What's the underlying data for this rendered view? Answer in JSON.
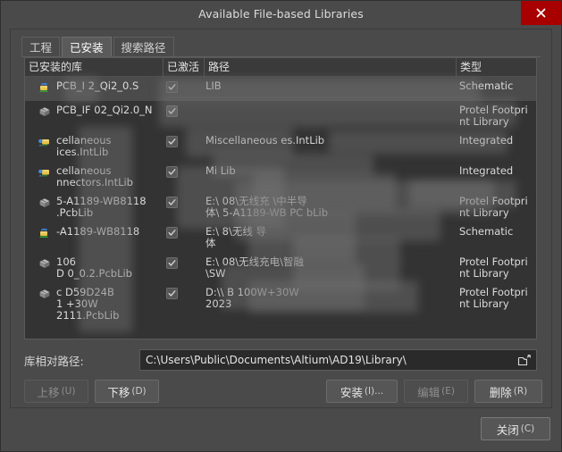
{
  "window": {
    "title": "Available File-based Libraries",
    "close_icon": "close-x-icon"
  },
  "tabs": [
    {
      "label": "工程",
      "active": false
    },
    {
      "label": "已安装",
      "active": true
    },
    {
      "label": "搜索路径",
      "active": false
    }
  ],
  "list": {
    "columns": [
      {
        "key": "name",
        "label": "已安装的库"
      },
      {
        "key": "activated",
        "label": "已激活"
      },
      {
        "key": "path",
        "label": "路径"
      },
      {
        "key": "type",
        "label": "类型"
      }
    ],
    "rows": [
      {
        "name": "PCB_I          2_Qi2_0.S",
        "activated": true,
        "path": "                                                  LIB",
        "type": "Schematic",
        "icon": "schematic-library-icon",
        "selected": true
      },
      {
        "name": "PCB_IF     02_Qi2.0_N",
        "activated": true,
        "path": "",
        "type": "Protel Footprint Library",
        "icon": "pcb-footprint-library-icon",
        "selected": false
      },
      {
        "name": "     cellaneous\n     ices.IntLib",
        "activated": true,
        "path": "Miscellaneous          es.IntLib",
        "type": "Integrated",
        "icon": "integrated-library-icon",
        "selected": false
      },
      {
        "name": "     cellaneous\n     nnectors.IntLib",
        "activated": true,
        "path": "Mi                              Lib",
        "type": "Integrated",
        "icon": "integrated-library-icon",
        "selected": false
      },
      {
        "name": "   5-A1189-WB8118\n   .PcbLib",
        "activated": true,
        "path": "E:\\                         08\\无线充        \\中半导\n体\\   5-A1189-WB      PC     bLib",
        "type": "Protel Footprint Library",
        "icon": "pcb-footprint-library-icon",
        "selected": false
      },
      {
        "name": "   -A1189-WB8118",
        "activated": true,
        "path": "E:\\                         8\\无线                 导\n体",
        "type": "Schematic",
        "icon": "schematic-library-icon",
        "selected": false
      },
      {
        "name": "       106\n   D       0_0.2.PcbLib",
        "activated": true,
        "path": "E:\\                          08\\无线充电\\智融\n\\SW",
        "type": "Protel Footprint Library",
        "icon": "pcb-footprint-library-icon",
        "selected": false
      },
      {
        "name": "   c      D59D24B\n   1         +30W\n           2111.PcbLib",
        "activated": true,
        "path": "D:\\\\                         B 100W+30W\n2023",
        "type": "Protel Footprint Library",
        "icon": "pcb-footprint-library-icon",
        "selected": false
      }
    ]
  },
  "relative_path": {
    "label": "库相对路径:",
    "value": "C:\\Users\\Public\\Documents\\Altium\\AD19\\Library\\",
    "browse_icon": "folder-browse-icon"
  },
  "buttons": {
    "move_up": {
      "label": "上移",
      "accel": "(U)",
      "enabled": false
    },
    "move_down": {
      "label": "下移",
      "accel": "(D)",
      "enabled": true
    },
    "install": {
      "label": "安装",
      "accel": "(I)...",
      "enabled": true
    },
    "edit": {
      "label": "编辑",
      "accel": "(E)",
      "enabled": false
    },
    "remove": {
      "label": "删除",
      "accel": "(R)",
      "enabled": true
    },
    "close": {
      "label": "关闭",
      "accel": "(C)",
      "enabled": true
    }
  },
  "colors": {
    "dialog_bg": "#4a4a4a",
    "list_bg": "#333333",
    "close_red": "#a80000",
    "text": "#dcdcdc",
    "selected_row": "#4b4b4b"
  }
}
